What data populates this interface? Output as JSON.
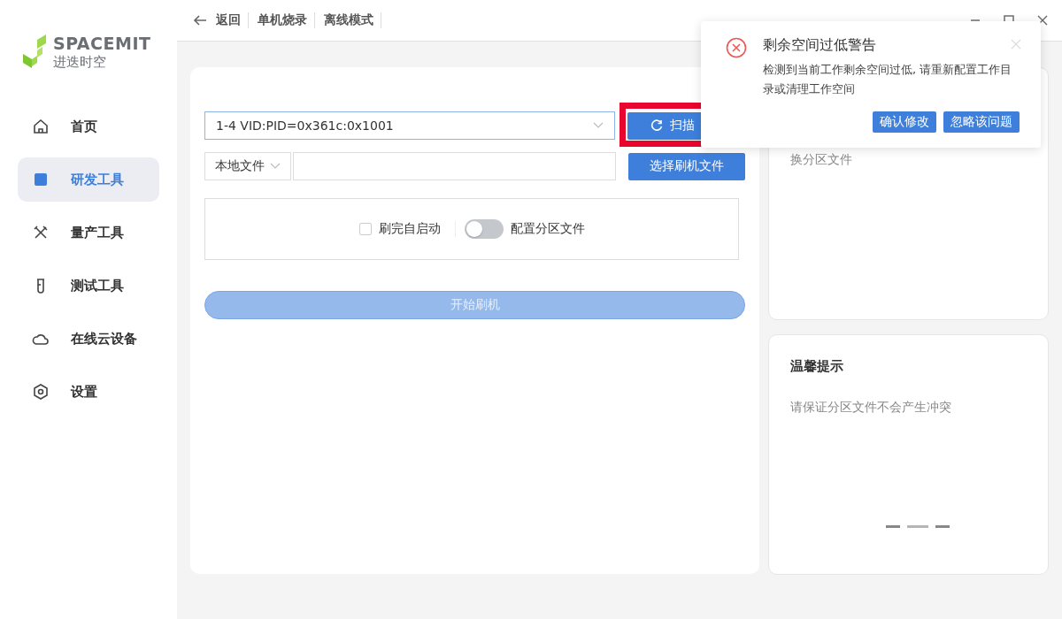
{
  "logo": {
    "name": "SPACEMIT",
    "subtitle": "进迭时空"
  },
  "sidebar": {
    "items": [
      {
        "label": "首页",
        "selected": false
      },
      {
        "label": "研发工具",
        "selected": true
      },
      {
        "label": "量产工具",
        "selected": false
      },
      {
        "label": "测试工具",
        "selected": false
      },
      {
        "label": "在线云设备",
        "selected": false
      },
      {
        "label": "设置",
        "selected": false
      }
    ]
  },
  "breadcrumb": [
    "返回",
    "单机烧录",
    "离线模式"
  ],
  "flash_panel": {
    "device_select": {
      "value": "1-4 VID:PID=0x361c:0x1001"
    },
    "scan_button": "扫描",
    "source_select": {
      "value": "本地文件"
    },
    "choose_file_button": "选择刷机文件",
    "auto_start": {
      "label": "刷完自启动",
      "checked": false
    },
    "partition_toggle": {
      "label": "配置分区文件",
      "on": false
    },
    "start_button": {
      "label": "开始刷机",
      "disabled": true
    }
  },
  "info_card": {
    "text": "换分区文件"
  },
  "tip_card": {
    "title": "温馨提示",
    "text": "请保证分区文件不会产生冲突",
    "pages": [
      {
        "selected": false
      },
      {
        "selected": true
      },
      {
        "selected": false
      }
    ]
  },
  "alert": {
    "title": "剩余空间过低警告",
    "message": "检测到当前工作剩余空间过低, 请重新配置工作目录或清理工作空间",
    "buttons": [
      "确认修改",
      "忽略该问题"
    ]
  }
}
